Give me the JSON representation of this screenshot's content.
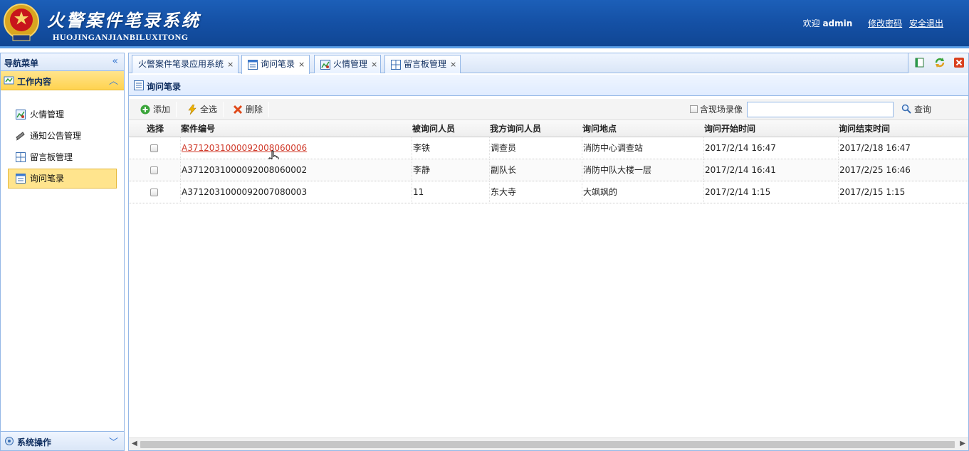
{
  "header": {
    "system_title": "火警案件笔录系统",
    "system_subtitle": "HUOJINGANJIANBILUXITONG",
    "welcome_prefix": "欢迎",
    "username": "admin",
    "change_password": "修改密码",
    "logout": "安全退出"
  },
  "nav": {
    "title": "导航菜单",
    "section_work": "工作内容",
    "items": [
      {
        "label": "火情管理",
        "icon": "fire-map-icon"
      },
      {
        "label": "通知公告管理",
        "icon": "announce-icon"
      },
      {
        "label": "留言板管理",
        "icon": "grid-icon"
      },
      {
        "label": "询问笔录",
        "icon": "form-icon"
      }
    ],
    "selected_index": 3,
    "section_system": "系统操作"
  },
  "tabs": [
    {
      "label": "火警案件笔录应用系统"
    },
    {
      "label": "询问笔录"
    },
    {
      "label": "火情管理"
    },
    {
      "label": "留言板管理"
    }
  ],
  "active_tab": 1,
  "panel": {
    "title": "询问笔录"
  },
  "toolbar": {
    "add": "添加",
    "select_all": "全选",
    "delete": "删除",
    "include_video": "含现场录像",
    "search_value": "",
    "search": "查询"
  },
  "grid": {
    "columns": [
      "选择",
      "案件编号",
      "被询问人员",
      "我方询问人员",
      "询问地点",
      "询问开始时间",
      "询问结束时间"
    ],
    "rows": [
      {
        "case_no": "A371203100009200806​0006",
        "interviewee": "李铁",
        "interviewer": "调查员",
        "location": "消防中心调查站",
        "start": "2017/2/14 16:47",
        "end": "2017/2/18 16:47"
      },
      {
        "case_no": "A3712031000092008060002",
        "interviewee": "李静",
        "interviewer": "副队长",
        "location": "消防中队大楼一层",
        "start": "2017/2/14 16:41",
        "end": "2017/2/25 16:46"
      },
      {
        "case_no": "A3712031000092007080003",
        "interviewee": "11",
        "interviewer": "东大寺",
        "location": "大飒飒的",
        "start": "2017/2/14 1:15",
        "end": "2017/2/15 1:15"
      }
    ]
  },
  "colors": {
    "header_blue": "#1551a6",
    "highlight_yellow": "#ffe48d",
    "border_blue": "#95b8e7",
    "link_red": "#d03a2a"
  }
}
